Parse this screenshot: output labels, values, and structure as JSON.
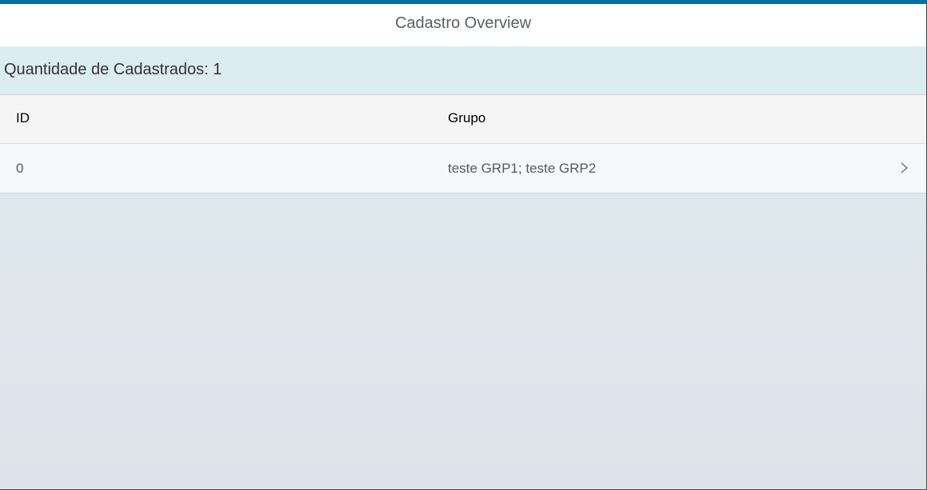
{
  "header": {
    "title": "Cadastro Overview"
  },
  "subheader": {
    "count_label": "Quantidade de Cadastrados: 1"
  },
  "table": {
    "columns": [
      "ID",
      "Grupo"
    ],
    "rows": [
      {
        "id": "0",
        "grupo": "teste GRP1; teste GRP2",
        "nav_icon": "chevron-right-icon"
      }
    ]
  },
  "colors": {
    "accent": "#0a6ea0",
    "header_bg": "#ffffff",
    "subheader_bg": "#dcedf1",
    "table_header_bg": "#f5f5f5",
    "row_bg": "#f5f9fa"
  }
}
